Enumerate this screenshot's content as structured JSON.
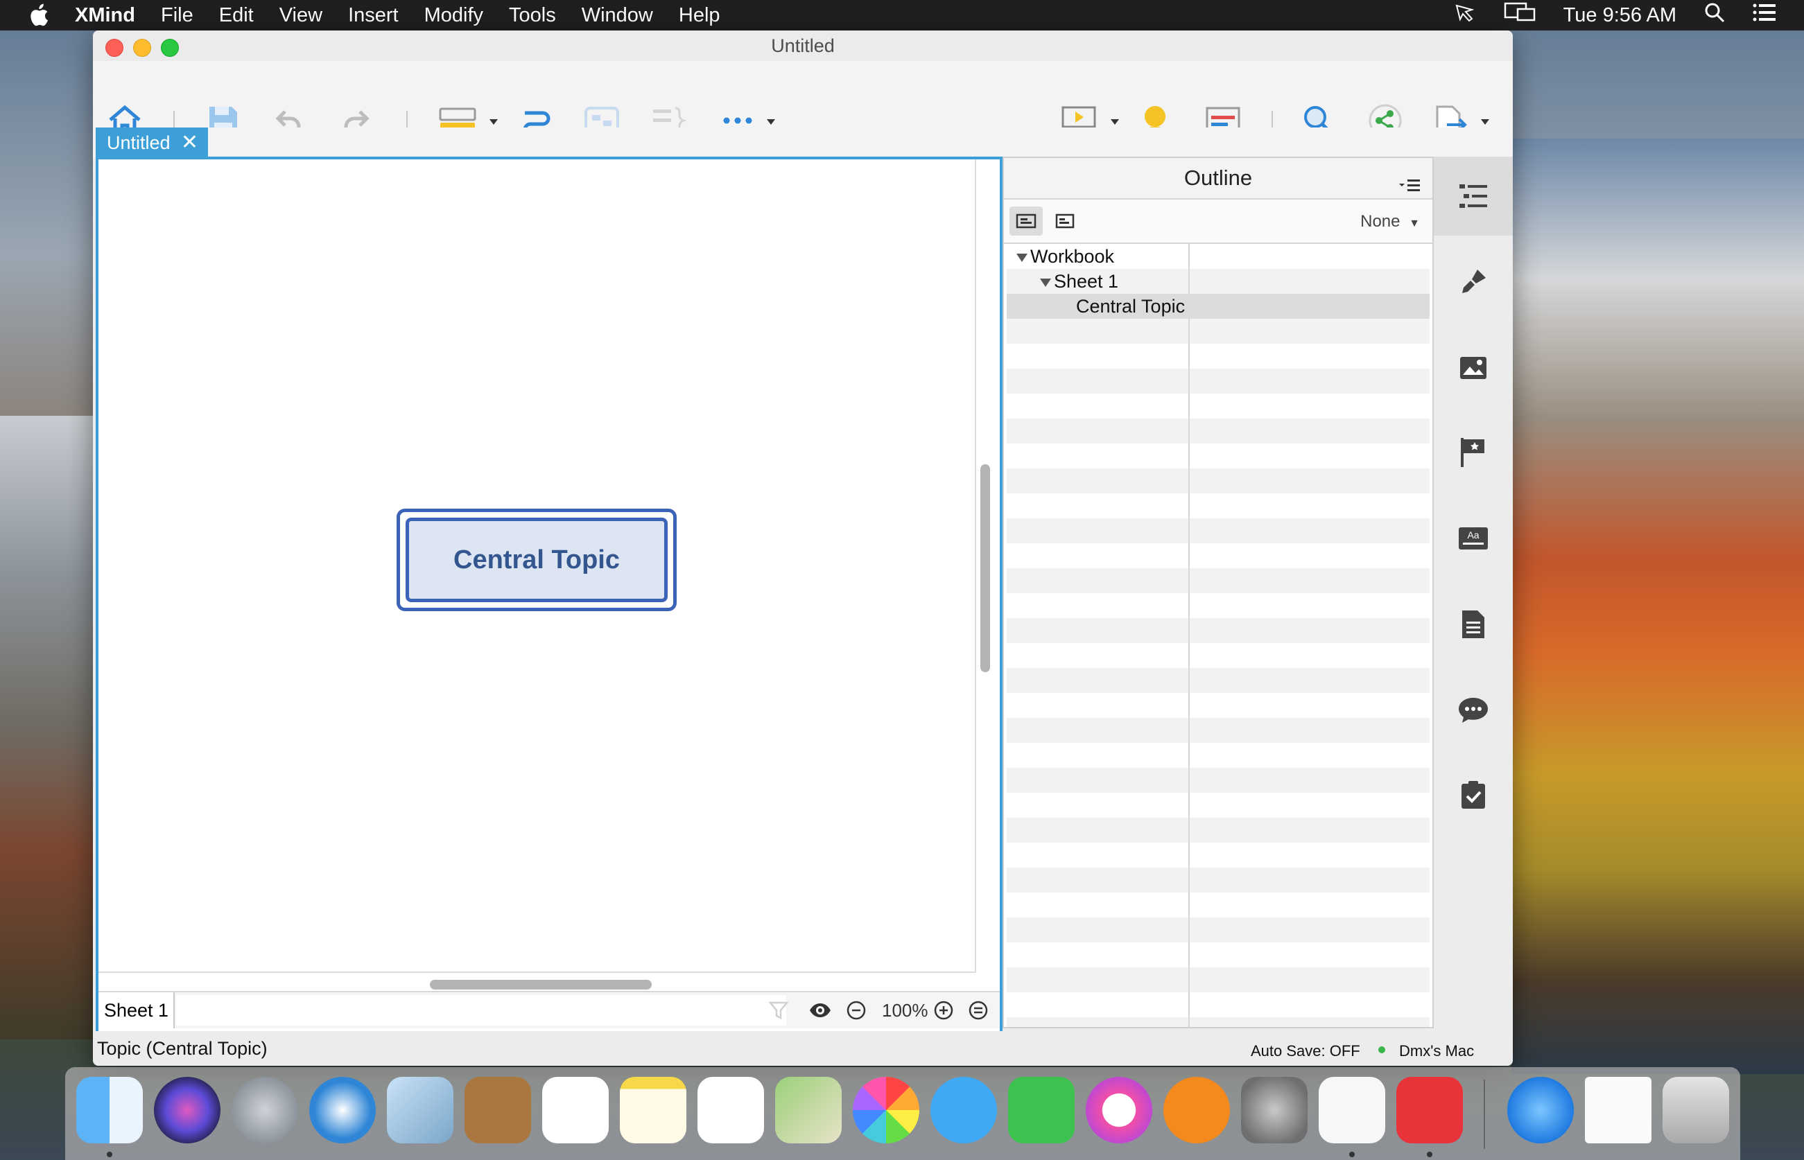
{
  "menubar": {
    "app_name": "XMind",
    "items": [
      "File",
      "Edit",
      "View",
      "Insert",
      "Modify",
      "Tools",
      "Window",
      "Help"
    ],
    "clock": "Tue 9:56 AM"
  },
  "window": {
    "title": "Untitled",
    "tab_label": "Untitled",
    "tab_close": "✕"
  },
  "toolbar": {
    "icons": [
      "home-icon",
      "save-icon",
      "undo-icon",
      "redo-icon",
      "topic-icon",
      "relationship-icon",
      "boundary-icon",
      "summary-icon",
      "more-icon",
      "presentation-icon",
      "brainstorm-icon",
      "gantt-icon",
      "search-icon",
      "share-icon",
      "export-icon"
    ]
  },
  "canvas": {
    "central_topic": "Central Topic"
  },
  "sheetbar": {
    "sheet_label": "Sheet 1",
    "zoom": "100%"
  },
  "outline": {
    "title": "Outline",
    "filter": "None",
    "rows": [
      {
        "label": "Workbook",
        "level": 0,
        "expanded": true
      },
      {
        "label": "Sheet 1",
        "level": 1,
        "expanded": true
      },
      {
        "label": "Central Topic",
        "level": 2,
        "selected": true
      }
    ]
  },
  "status": {
    "selection": "Topic (Central Topic)",
    "autosave": "Auto Save: OFF",
    "user": "Dmx's Mac"
  },
  "colors": {
    "accent": "#3d9fd8",
    "topic_border": "#3b63b8",
    "topic_fill": "#dde5f2",
    "topic_text": "#34568f"
  }
}
